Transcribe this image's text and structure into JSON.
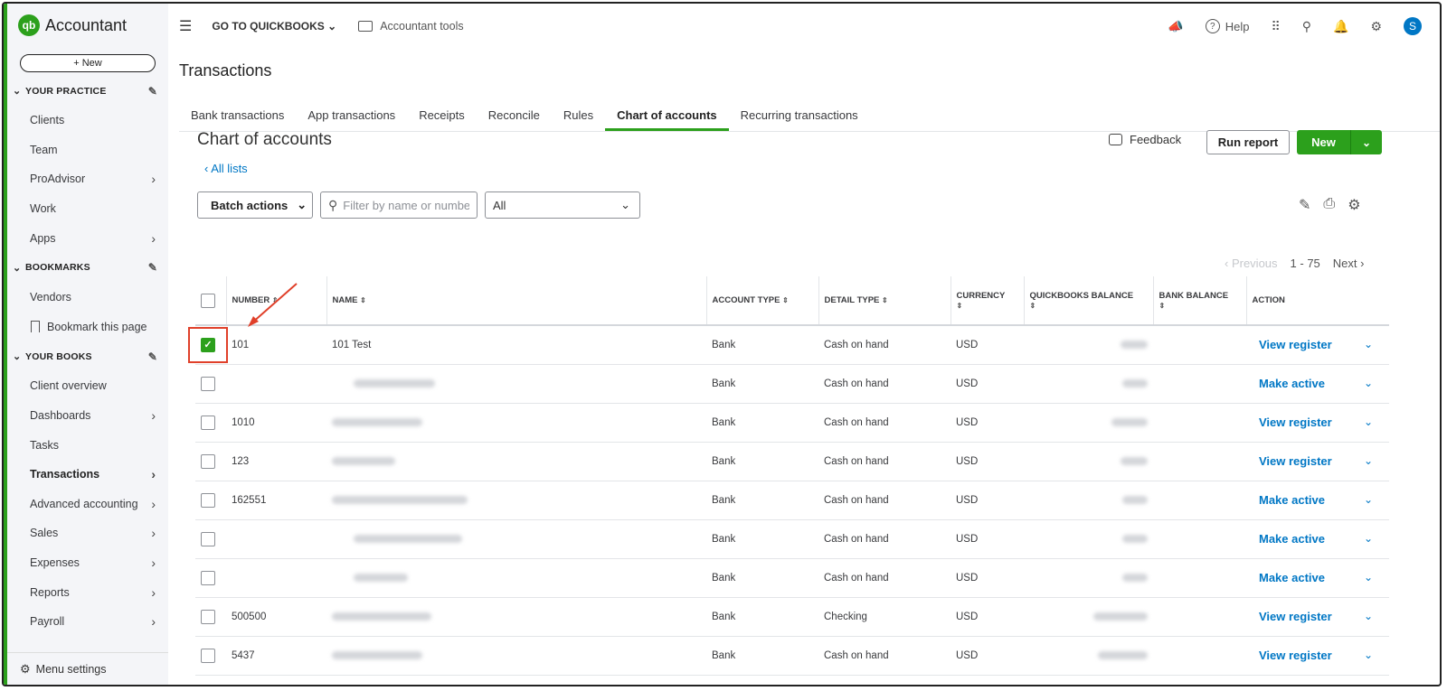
{
  "brand": {
    "name": "Accountant",
    "logo": "qb"
  },
  "sidebar": {
    "new_label": "+ New",
    "sections": [
      {
        "title": "YOUR PRACTICE",
        "items": [
          "Clients",
          "Team",
          "ProAdvisor",
          "Work",
          "Apps"
        ]
      },
      {
        "title": "BOOKMARKS",
        "items": [
          "Vendors",
          "Bookmark this page"
        ]
      },
      {
        "title": "YOUR BOOKS",
        "items": [
          "Client overview",
          "Dashboards",
          "Tasks",
          "Transactions",
          "Advanced accounting",
          "Sales",
          "Expenses",
          "Reports",
          "Payroll"
        ]
      }
    ],
    "menu_settings": "Menu settings"
  },
  "topbar": {
    "goto": "GO TO QUICKBOOKS",
    "accountant_tools": "Accountant tools",
    "help": "Help",
    "avatar": "S"
  },
  "page": {
    "title": "Transactions"
  },
  "tabs": [
    "Bank transactions",
    "App transactions",
    "Receipts",
    "Reconcile",
    "Rules",
    "Chart of accounts",
    "Recurring transactions"
  ],
  "active_tab": "Chart of accounts",
  "coa": {
    "title": "Chart of accounts",
    "all_lists": "All lists",
    "feedback": "Feedback",
    "run_report": "Run report",
    "new": "New",
    "batch_actions": "Batch actions",
    "filter_placeholder": "Filter by name or number",
    "type_filter": "All",
    "pager": {
      "prev": "Previous",
      "range": "1 - 75",
      "next": "Next"
    }
  },
  "table": {
    "columns": [
      "NUMBER",
      "NAME",
      "ACCOUNT TYPE",
      "DETAIL TYPE",
      "CURRENCY",
      "QUICKBOOKS BALANCE",
      "BANK BALANCE",
      "ACTION"
    ],
    "rows": [
      {
        "checked": true,
        "number": "101",
        "name": "101 Test",
        "type": "Bank",
        "detail": "Cash on hand",
        "currency": "USD",
        "action": "View register"
      },
      {
        "checked": false,
        "number": "",
        "name": "",
        "type": "Bank",
        "detail": "Cash on hand",
        "currency": "USD",
        "action": "Make active"
      },
      {
        "checked": false,
        "number": "1010",
        "name": "",
        "type": "Bank",
        "detail": "Cash on hand",
        "currency": "USD",
        "action": "View register"
      },
      {
        "checked": false,
        "number": "123",
        "name": "",
        "type": "Bank",
        "detail": "Cash on hand",
        "currency": "USD",
        "action": "View register"
      },
      {
        "checked": false,
        "number": "162551",
        "name": "",
        "type": "Bank",
        "detail": "Cash on hand",
        "currency": "USD",
        "action": "Make active"
      },
      {
        "checked": false,
        "number": "",
        "name": "",
        "type": "Bank",
        "detail": "Cash on hand",
        "currency": "USD",
        "action": "Make active"
      },
      {
        "checked": false,
        "number": "",
        "name": "",
        "type": "Bank",
        "detail": "Cash on hand",
        "currency": "USD",
        "action": "Make active"
      },
      {
        "checked": false,
        "number": "500500",
        "name": "",
        "type": "Bank",
        "detail": "Checking",
        "currency": "USD",
        "action": "View register"
      },
      {
        "checked": false,
        "number": "5437",
        "name": "",
        "type": "Bank",
        "detail": "Cash on hand",
        "currency": "USD",
        "action": "View register"
      }
    ]
  },
  "colors": {
    "brand_green": "#2ca01c",
    "link_blue": "#0077c5",
    "annotation_red": "#e0402a"
  }
}
